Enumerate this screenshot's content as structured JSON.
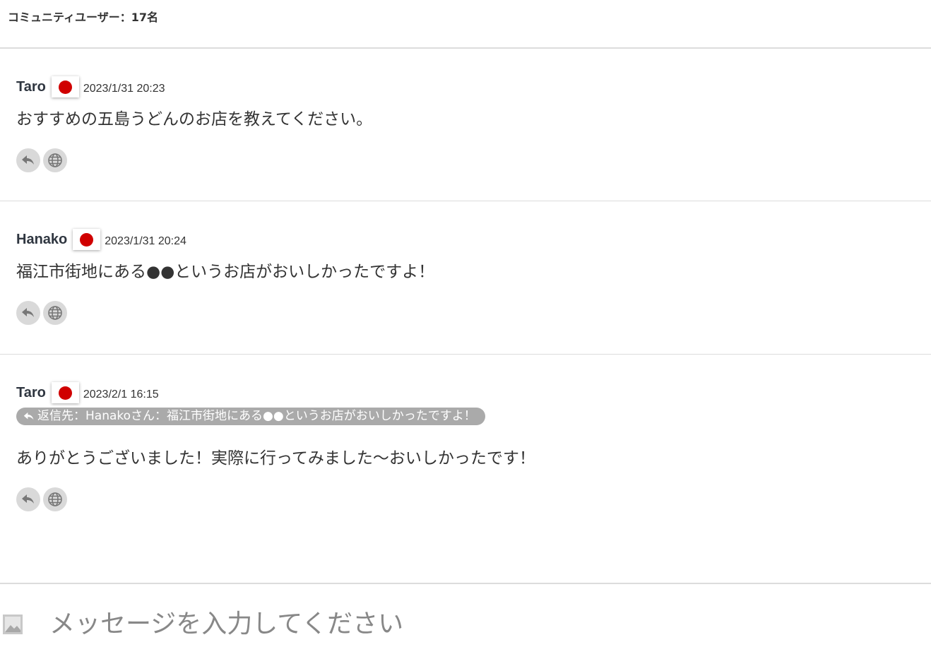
{
  "header": {
    "user_count": "コミュニティユーザー：17名"
  },
  "messages": [
    {
      "user": "Taro",
      "flag": "japan-flag",
      "time": "2023/1/31 20:23",
      "text": "おすすめの五島うどんのお店を教えてください。"
    },
    {
      "user": "Hanako",
      "flag": "japan-flag",
      "time": "2023/1/31 20:24",
      "text": "福江市街地にある●●というお店がおいしかったですよ！"
    },
    {
      "user": "Taro",
      "flag": "japan-flag",
      "time": "2023/2/1 16:15",
      "reply_to": "返信先：Hanakoさん：福江市街地にある●●というお店がおいしかったですよ！",
      "text": "ありがとうございました！実際に行ってみました〜おいしかったです！"
    }
  ],
  "actions": {
    "reply_icon": "reply-icon",
    "translate_icon": "globe-icon"
  },
  "composer": {
    "placeholder": "メッセージを入力してください",
    "image_icon": "image-icon"
  },
  "colors": {
    "flag_red": "#d00000",
    "reply_bg": "#aaaaaa",
    "action_bg": "#d9d9d9"
  }
}
